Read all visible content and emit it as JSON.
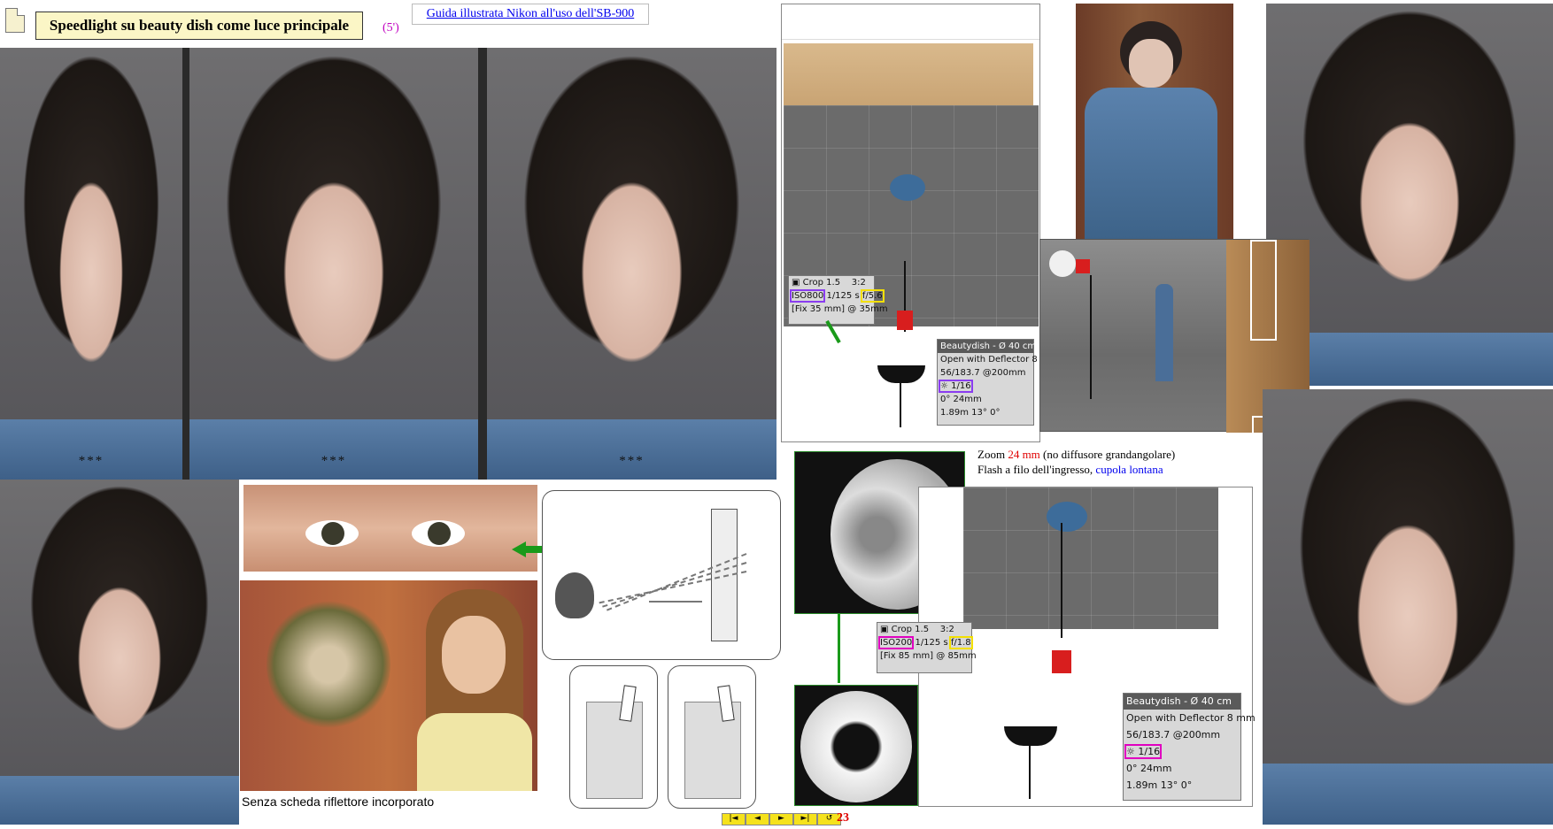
{
  "header": {
    "title": "Speedlight su beauty dish come luce principale",
    "duration": "(5')",
    "guide_link": "Guida illustrata Nikon all'uso dell'SB-900"
  },
  "portraits": {
    "ratings": [
      "***",
      "***",
      "***"
    ]
  },
  "top_diagram": {
    "camera": {
      "crop": "Crop 1.5",
      "ratio": "3:2",
      "iso": "ISO800",
      "shutter": "1/125 s",
      "aperture": "f/5.6",
      "lens": "[Fix 35 mm] @ 35mm"
    },
    "light": {
      "title": "Beautydish - Ø 40 cm",
      "modifier": "Open with Deflector 8 mm",
      "flash_spec": "56/183.7 @200mm",
      "power": "1/16",
      "angles": "0°  24mm",
      "position": "1.89m  13°  0°"
    }
  },
  "zoom_note": {
    "line1_prefix": "Zoom ",
    "line1_value": "24 mm",
    "line1_suffix": " (no diffusore grandangolare)",
    "line2_prefix": "Flash a filo dell'ingresso, ",
    "line2_link": "cupola lontana"
  },
  "bottom_diagram": {
    "camera": {
      "crop": "Crop 1.5",
      "ratio": "3:2",
      "iso": "ISO200",
      "shutter": "1/125 s",
      "aperture": "f/1.8",
      "lens": "[Fix 85 mm] @ 85mm"
    },
    "light": {
      "title": "Beautydish - Ø 40 cm",
      "modifier": "Open with Deflector 8 mm",
      "flash_spec": "56/183.7 @200mm",
      "power": "1/16",
      "angles": "0°  24mm",
      "position": "1.89m  13°  0°"
    }
  },
  "caption": "Senza scheda riflettore incorporato",
  "nav": {
    "buttons": [
      "|◄",
      "◄",
      "►",
      "►|",
      "↺"
    ],
    "page": "23"
  }
}
